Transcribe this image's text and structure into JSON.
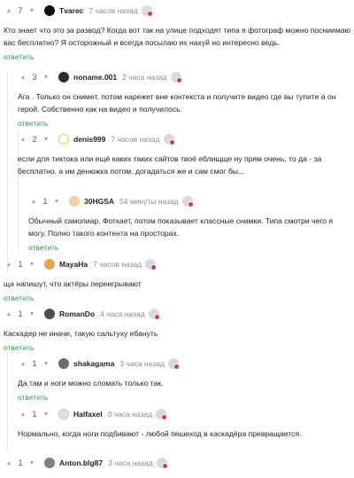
{
  "comments": [
    {
      "score": "7",
      "user": "Tvarec",
      "time": "7 часов назад",
      "text": "Кто знает что это за развод? Когда вот так на улице подходят типа я фотограф можно посниимаю вас бесплатно? Я осторожный и всегда посылаю их нахуй но интересно ведь.",
      "reply": "ответить"
    },
    {
      "score": "3",
      "user": "noname.001",
      "time": "2 часа назад",
      "text": "Ага . Только он снимет, потом нарежет вне контекста и получите видео где вы тупите а он герой. Собственно как на видео и получилось.",
      "reply": "ответить"
    },
    {
      "score": "2",
      "user": "denis999",
      "time": "7 часов назад",
      "text": "если для тиктока или ещё каких таких сайтов твоё еблищще ну прям очень, то да - за бесплатно. а им денюжка потом. догадаться же и сам смог бы...",
      "reply": "ответить"
    },
    {
      "score": "1",
      "user": "30HGSA",
      "time": "54 минуты назад",
      "text": "Обычный самопиар. Фоткает, потом показывает классные снимки. Типа смотри чего я могу. Полно такого контента на просторах.",
      "reply": "ответить"
    },
    {
      "score": "1",
      "user": "MayaHa",
      "time": "7 часов назад",
      "text": "ща напишут, что актёры переигрывают",
      "reply": "ответить"
    },
    {
      "score": "1",
      "user": "RomanDo",
      "time": "4 часа назад",
      "text": "Каскадер не иначе, такую сальтуху ебануть",
      "reply": "ответить"
    },
    {
      "score": "1",
      "user": "shakagama",
      "time": "3 часа назад",
      "text": "Да там и ноги можно сломать только так.",
      "reply": "ответить"
    },
    {
      "score": "1",
      "user": "Halfaxel",
      "time": "3 часа назад",
      "text": "Нормально, когда ноги подбивают - любой пешеход в каскадёра превращается.",
      "reply": "ответить"
    },
    {
      "score": "1",
      "user": "Anton.blg87",
      "time": "3 часа назад",
      "text": "",
      "reply": ""
    }
  ]
}
